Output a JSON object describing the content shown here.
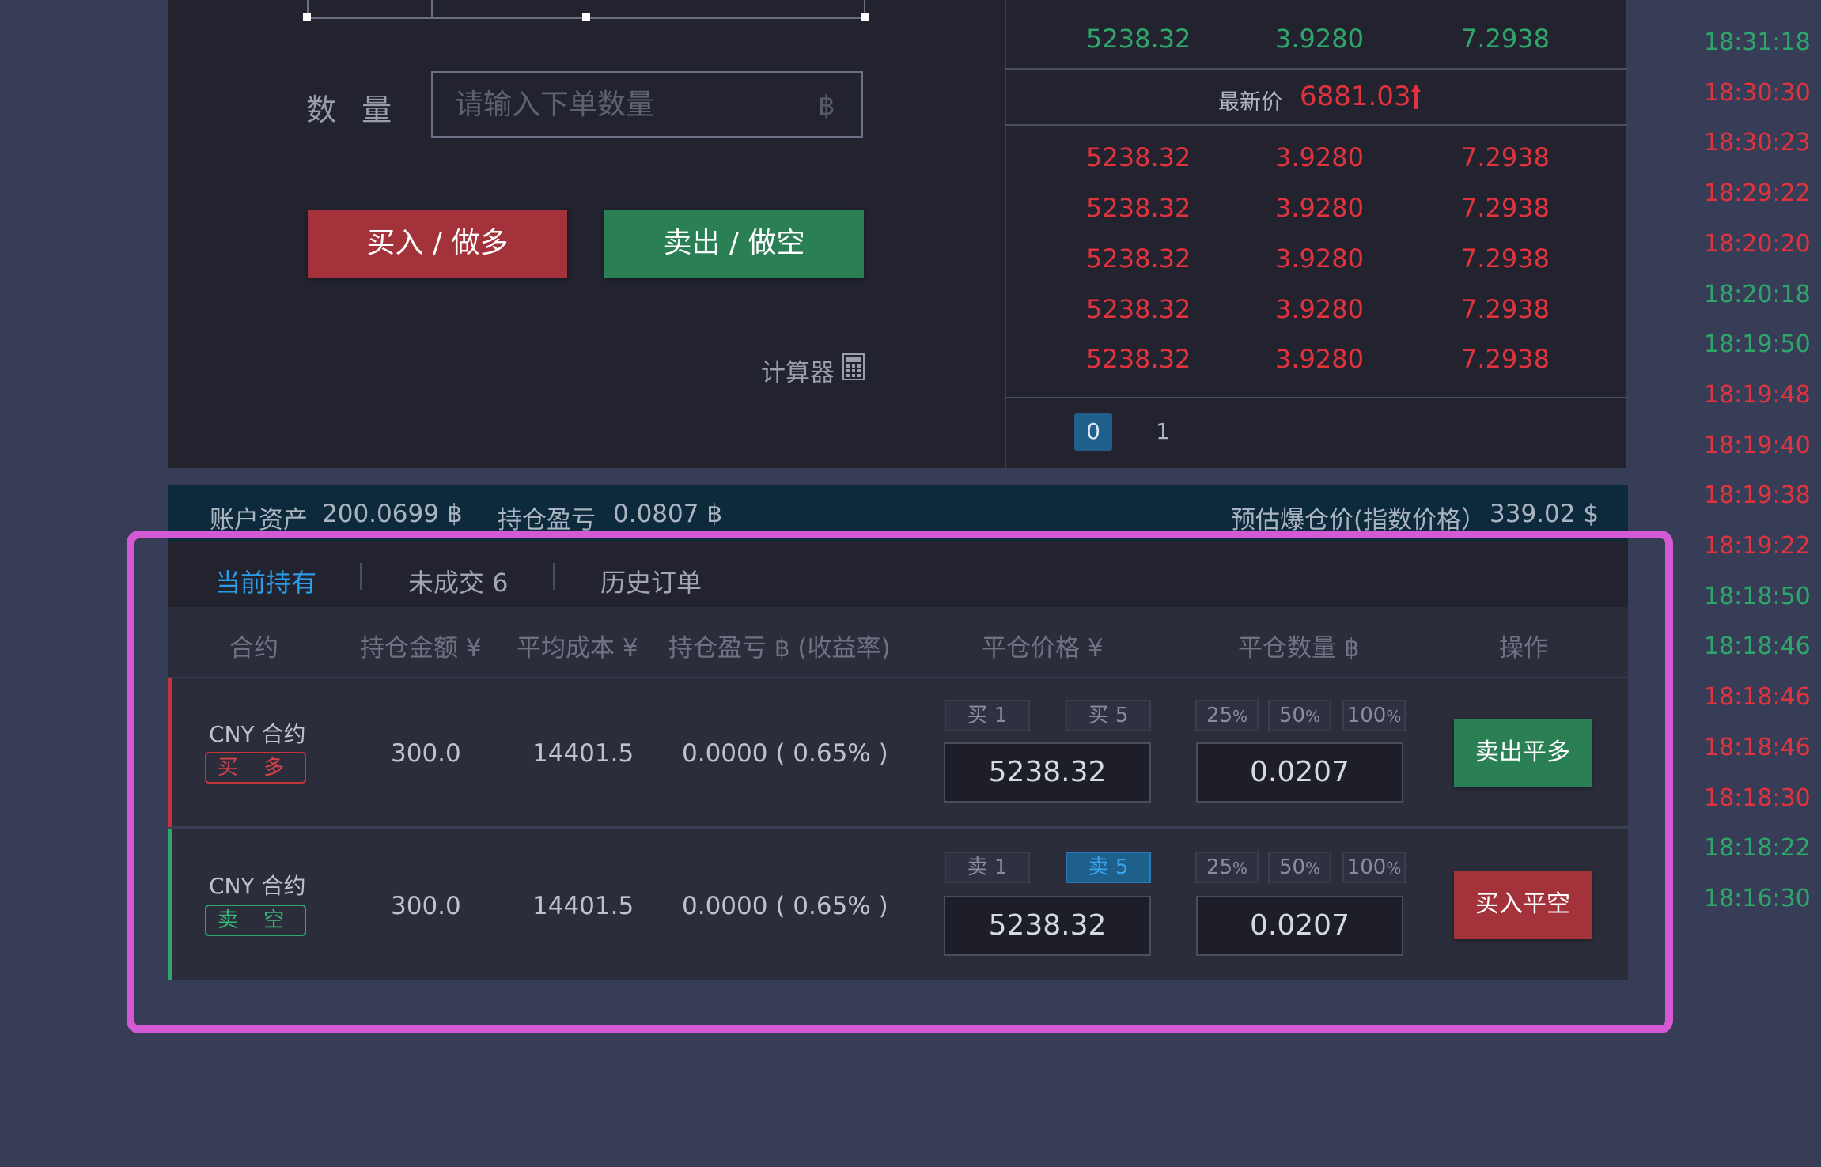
{
  "order_form": {
    "qty_label": "数 量",
    "qty_placeholder": "请输入下单数量",
    "qty_unit": "฿",
    "buy_label": "买入 / 做多",
    "sell_label": "卖出 / 做空",
    "calculator_label": "计算器",
    "calculator_icon": "calculator-icon"
  },
  "order_book": {
    "top_row": {
      "price": "5238.32",
      "qty": "3.9280",
      "total": "7.2938"
    },
    "latest_label": "最新价",
    "latest_value": "6881.03",
    "latest_icon": "arrow-up-icon",
    "asks": [
      {
        "price": "5238.32",
        "qty": "3.9280",
        "total": "7.2938"
      },
      {
        "price": "5238.32",
        "qty": "3.9280",
        "total": "7.2938"
      },
      {
        "price": "5238.32",
        "qty": "3.9280",
        "total": "7.2938"
      },
      {
        "price": "5238.32",
        "qty": "3.9280",
        "total": "7.2938"
      },
      {
        "price": "5238.32",
        "qty": "3.9280",
        "total": "7.2938"
      }
    ],
    "pages": [
      "0",
      "1"
    ],
    "active_page": "0"
  },
  "trades": [
    {
      "time": "18:31:18",
      "side": "buy"
    },
    {
      "time": "18:30:30",
      "side": "sell"
    },
    {
      "time": "18:30:23",
      "side": "sell"
    },
    {
      "time": "18:29:22",
      "side": "sell"
    },
    {
      "time": "18:20:20",
      "side": "sell"
    },
    {
      "time": "18:20:18",
      "side": "buy"
    },
    {
      "time": "18:19:50",
      "side": "buy"
    },
    {
      "time": "18:19:48",
      "side": "sell"
    },
    {
      "time": "18:19:40",
      "side": "sell"
    },
    {
      "time": "18:19:38",
      "side": "sell"
    },
    {
      "time": "18:19:22",
      "side": "sell"
    },
    {
      "time": "18:18:50",
      "side": "buy"
    },
    {
      "time": "18:18:46",
      "side": "buy"
    },
    {
      "time": "18:18:46",
      "side": "sell"
    },
    {
      "time": "18:18:46",
      "side": "sell"
    },
    {
      "time": "18:18:30",
      "side": "sell"
    },
    {
      "time": "18:18:22",
      "side": "buy"
    },
    {
      "time": "18:16:30",
      "side": "buy"
    }
  ],
  "account": {
    "assets_label": "账户资产",
    "assets_value": "200.0699 ฿",
    "pnl_label": "持仓盈亏",
    "pnl_value": "0.0807 ฿",
    "liq_label": "预估爆仓价(指数价格）",
    "liq_value": "339.02 $"
  },
  "tabs": {
    "current": "当前持有",
    "open": "未成交 6",
    "history": "历史订单"
  },
  "table_head": {
    "contract": "合约",
    "amount": "持仓金额 ¥",
    "avg_cost": "平均成本 ¥",
    "pnl": "持仓盈亏 ฿ (收益率)",
    "close_price": "平仓价格 ¥",
    "close_qty": "平仓数量 ฿",
    "action": "操作"
  },
  "positions": [
    {
      "contract": "CNY 合约",
      "side": "买 多",
      "amount": "300.0",
      "avg_cost": "14401.5",
      "pnl": "0.0000 ( 0.65% )",
      "price_btn_a": "买 1",
      "price_btn_b": "买 5",
      "price": "5238.32",
      "qty": "0.0207",
      "action": "卖出平多"
    },
    {
      "contract": "CNY 合约",
      "side": "卖 空",
      "amount": "300.0",
      "avg_cost": "14401.5",
      "pnl": "0.0000 ( 0.65% )",
      "price_btn_a": "卖 1",
      "price_btn_b": "卖 5",
      "price": "5238.32",
      "qty": "0.0207",
      "action": "买入平空"
    }
  ],
  "pct_buttons": [
    {
      "num": "25",
      "unit": "%"
    },
    {
      "num": "50",
      "unit": "%"
    },
    {
      "num": "100",
      "unit": "%"
    }
  ],
  "colors": {
    "buy": "#2ea66a",
    "sell": "#e0333d",
    "accent": "#2a9ce8",
    "highlight": "#d35ad4"
  }
}
